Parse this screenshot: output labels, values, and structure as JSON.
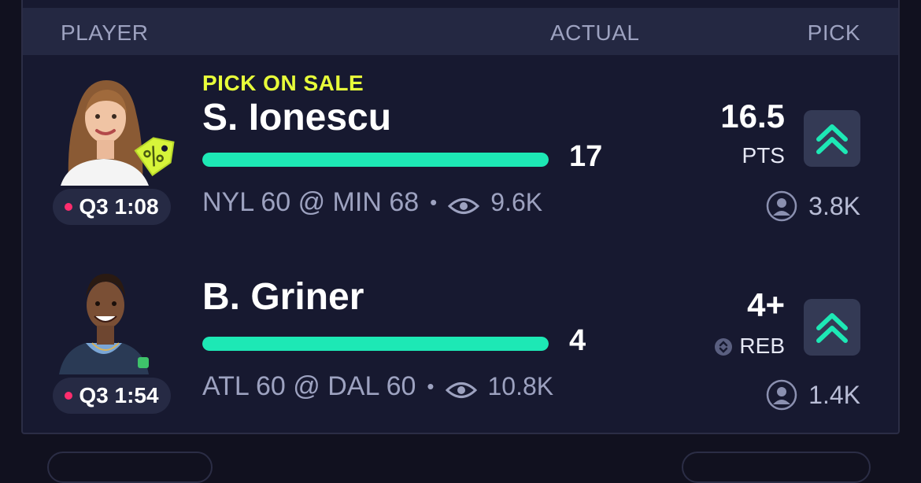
{
  "header": {
    "player": "PLAYER",
    "actual": "ACTUAL",
    "pick": "PICK"
  },
  "colors": {
    "accent": "#1de8b5",
    "sale": "#e8ff3a",
    "live": "#ff2d6e",
    "background": "#171930"
  },
  "rows": [
    {
      "sale_label": "PICK ON SALE",
      "name": "S. Ionescu",
      "status": "Q3 1:08",
      "actual": "17",
      "progress": 1.0,
      "game": "NYL 60 @ MIN 68",
      "separator": "•",
      "views": "9.6K",
      "line": "16.5",
      "stat": "PTS",
      "picks": "3.8K",
      "icons": [
        "player-photo",
        "sale-tag-icon",
        "eye-icon",
        "double-chevron-up-icon",
        "user-icon"
      ]
    },
    {
      "name": "B. Griner",
      "status": "Q3 1:54",
      "actual": "4",
      "progress": 1.0,
      "game": "ATL 60 @ DAL 60",
      "separator": "•",
      "views": "10.8K",
      "line": "4+",
      "stat": "REB",
      "picks": "1.4K",
      "icons": [
        "player-photo",
        "swap-icon",
        "eye-icon",
        "double-chevron-up-icon",
        "user-icon"
      ]
    }
  ]
}
